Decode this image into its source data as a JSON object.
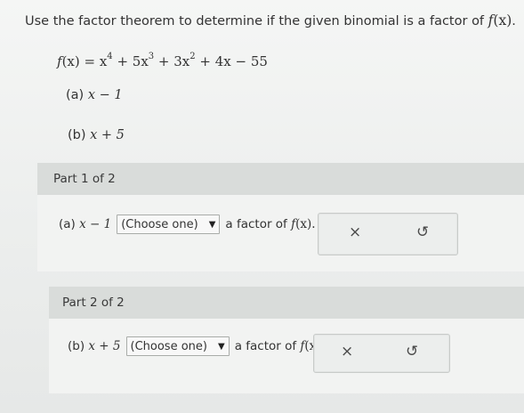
{
  "question": {
    "prompt": "Use the factor theorem to determine if the given binomial is a factor of",
    "function_name": "f",
    "function_arg": "(x)",
    "period": "."
  },
  "function_def": {
    "lhs": "f",
    "lhs_arg": "(x) = x",
    "exp4": "4",
    "t2": " + 5x",
    "exp3": "3",
    "t3": " + 3x",
    "exp2": "2",
    "t4": " + 4x − 55"
  },
  "parts_list": {
    "a_label": "(a)",
    "a_binomial": "x − 1",
    "b_label": "(b)",
    "b_binomial": "x + 5"
  },
  "part1": {
    "header": "Part 1 of 2",
    "label": "(a)",
    "binomial": "x − 1",
    "select_value": "(Choose one)",
    "suffix": "a factor of",
    "fname": "f",
    "farg": "(x).",
    "clear_icon": "×",
    "undo_icon": "↺"
  },
  "part2": {
    "header": "Part 2 of 2",
    "label": "(b)",
    "binomial": "x + 5",
    "select_value": "(Choose one)",
    "suffix": "a factor of",
    "fname": "f",
    "farg": "(x).",
    "clear_icon": "×",
    "undo_icon": "↺"
  }
}
